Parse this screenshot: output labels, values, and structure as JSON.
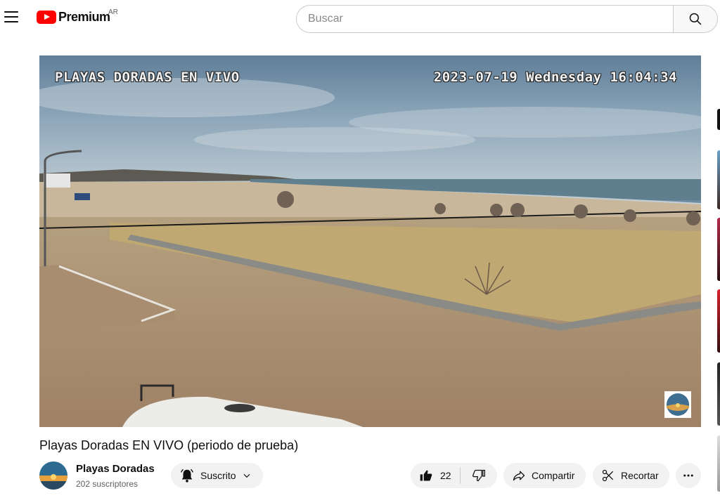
{
  "header": {
    "logo_text": "Premium",
    "country_code": "AR",
    "search_placeholder": "Buscar"
  },
  "player": {
    "overlay_title": "PLAYAS DORADAS EN VIVO",
    "overlay_timestamp": "2023-07-19 Wednesday 16:04:34"
  },
  "video": {
    "title": "Playas Doradas EN VIVO (periodo de prueba)"
  },
  "channel": {
    "name": "Playas Doradas",
    "subscribers": "202 suscriptores"
  },
  "actions": {
    "subscribe_label": "Suscrito",
    "like_count": "22",
    "share_label": "Compartir",
    "clip_label": "Recortar"
  },
  "colors": {
    "brand_red": "#ff0000",
    "pill_bg": "#f2f2f2"
  },
  "icons": [
    "menu-icon",
    "youtube-logo-icon",
    "search-icon",
    "bell-icon",
    "chevron-down-icon",
    "thumbs-up-icon",
    "thumbs-down-icon",
    "share-icon",
    "scissors-icon",
    "more-icon"
  ]
}
